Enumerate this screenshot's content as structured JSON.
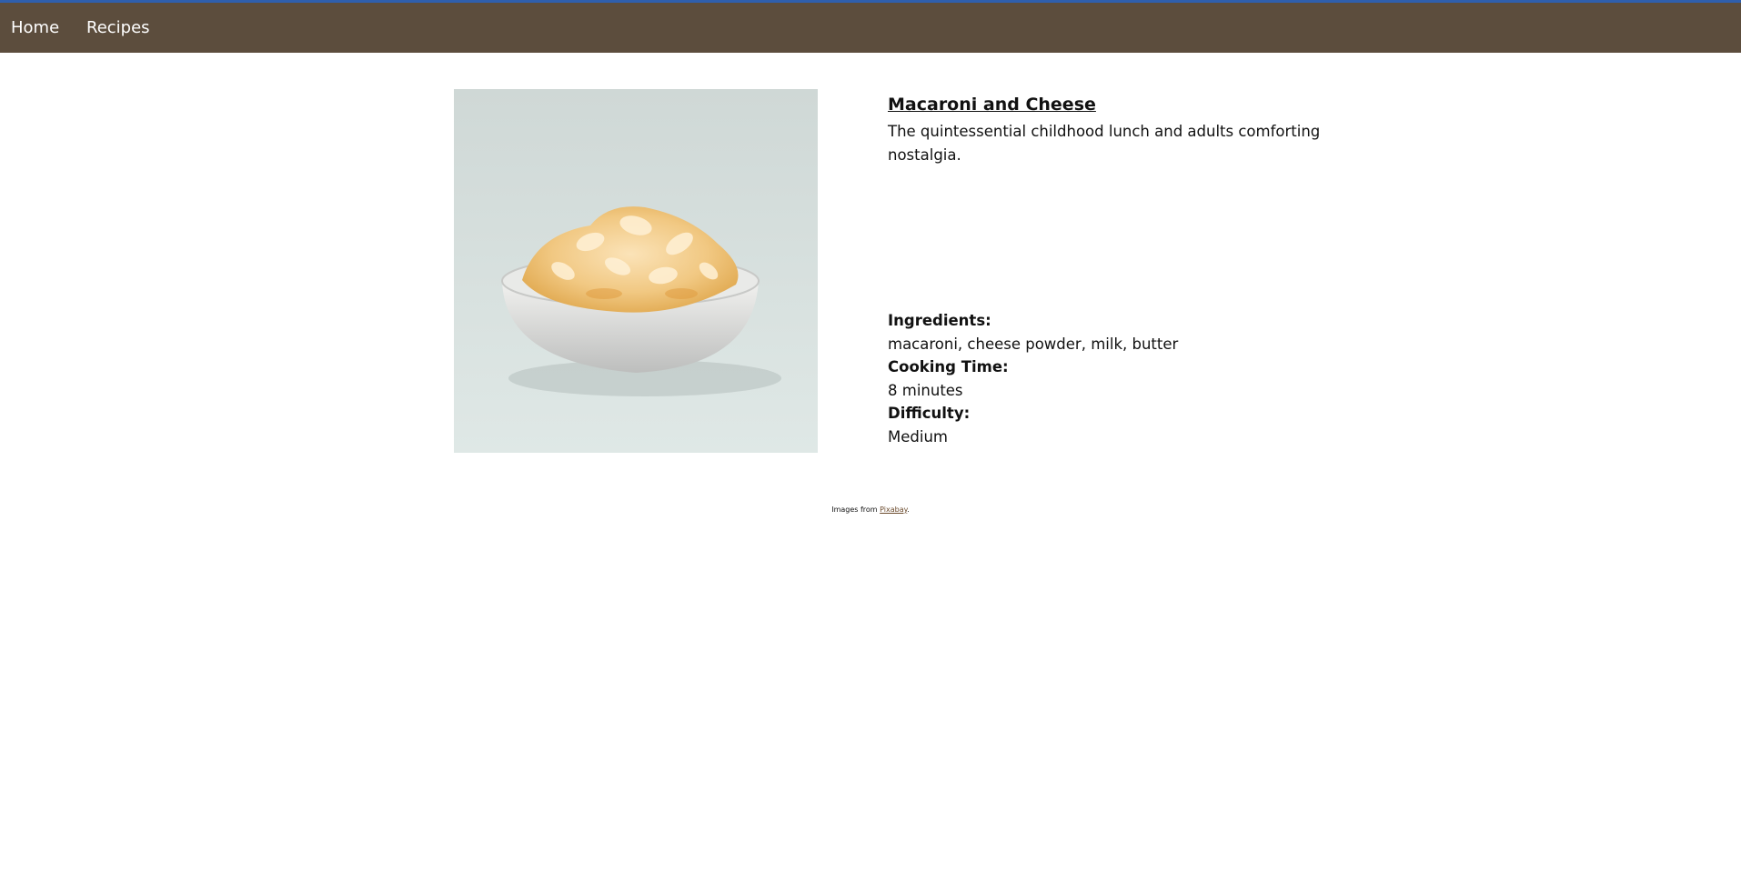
{
  "nav": {
    "items": [
      {
        "label": "Home"
      },
      {
        "label": "Recipes"
      }
    ]
  },
  "recipe": {
    "title": "Macaroni and Cheese",
    "description": "The quintessential childhood lunch and adults comforting nostalgia.",
    "image_subject": "bowl of macaroni and cheese",
    "ingredients_label": "Ingredients:",
    "ingredients": "macaroni, cheese powder, milk, butter",
    "cooking_time_label": "Cooking Time:",
    "cooking_time": "8 minutes",
    "difficulty_label": "Difficulty:",
    "difficulty": "Medium"
  },
  "footer": {
    "prefix": "Images from ",
    "link_label": "Pixabay",
    "suffix": "."
  },
  "colors": {
    "nav_bar": "#5c4d3d",
    "nav_top_border": "#2f5fae",
    "link": "#6b4a2c"
  }
}
